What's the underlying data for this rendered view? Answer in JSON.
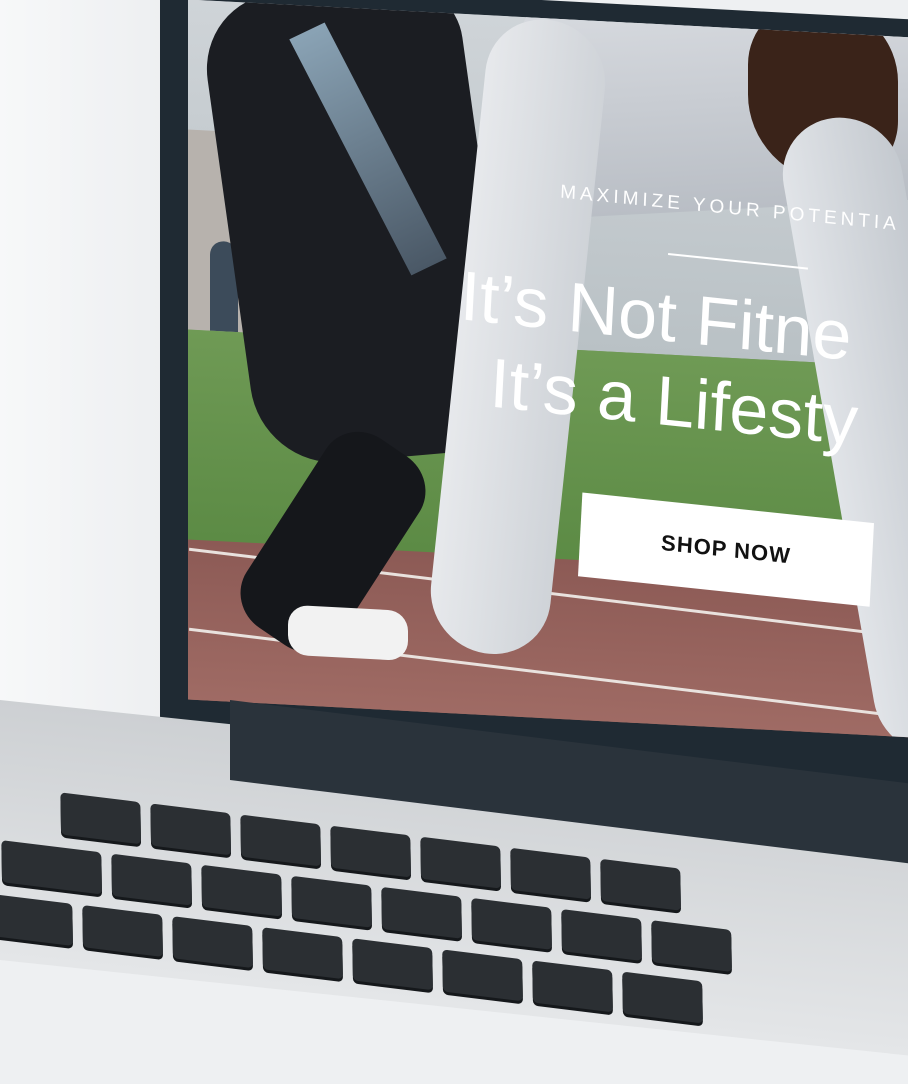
{
  "hero": {
    "tagline": "MAXIMIZE YOUR POTENTIA",
    "headline_line1": "It’s Not Fitne",
    "headline_line2": "It’s a Lifesty",
    "cta_label": "SHOP NOW"
  },
  "keyboard": {
    "row1": [
      "",
      "",
      "",
      "",
      "",
      "",
      "",
      ""
    ],
    "row2": [
      "",
      "",
      "",
      "",
      "",
      "",
      "",
      ""
    ],
    "row3": [
      "",
      "",
      "",
      "",
      "",
      "",
      "",
      ""
    ]
  },
  "colors": {
    "laptop_bezel": "#1f2a33",
    "button_bg": "#ffffff",
    "text_light": "#ffffff"
  }
}
